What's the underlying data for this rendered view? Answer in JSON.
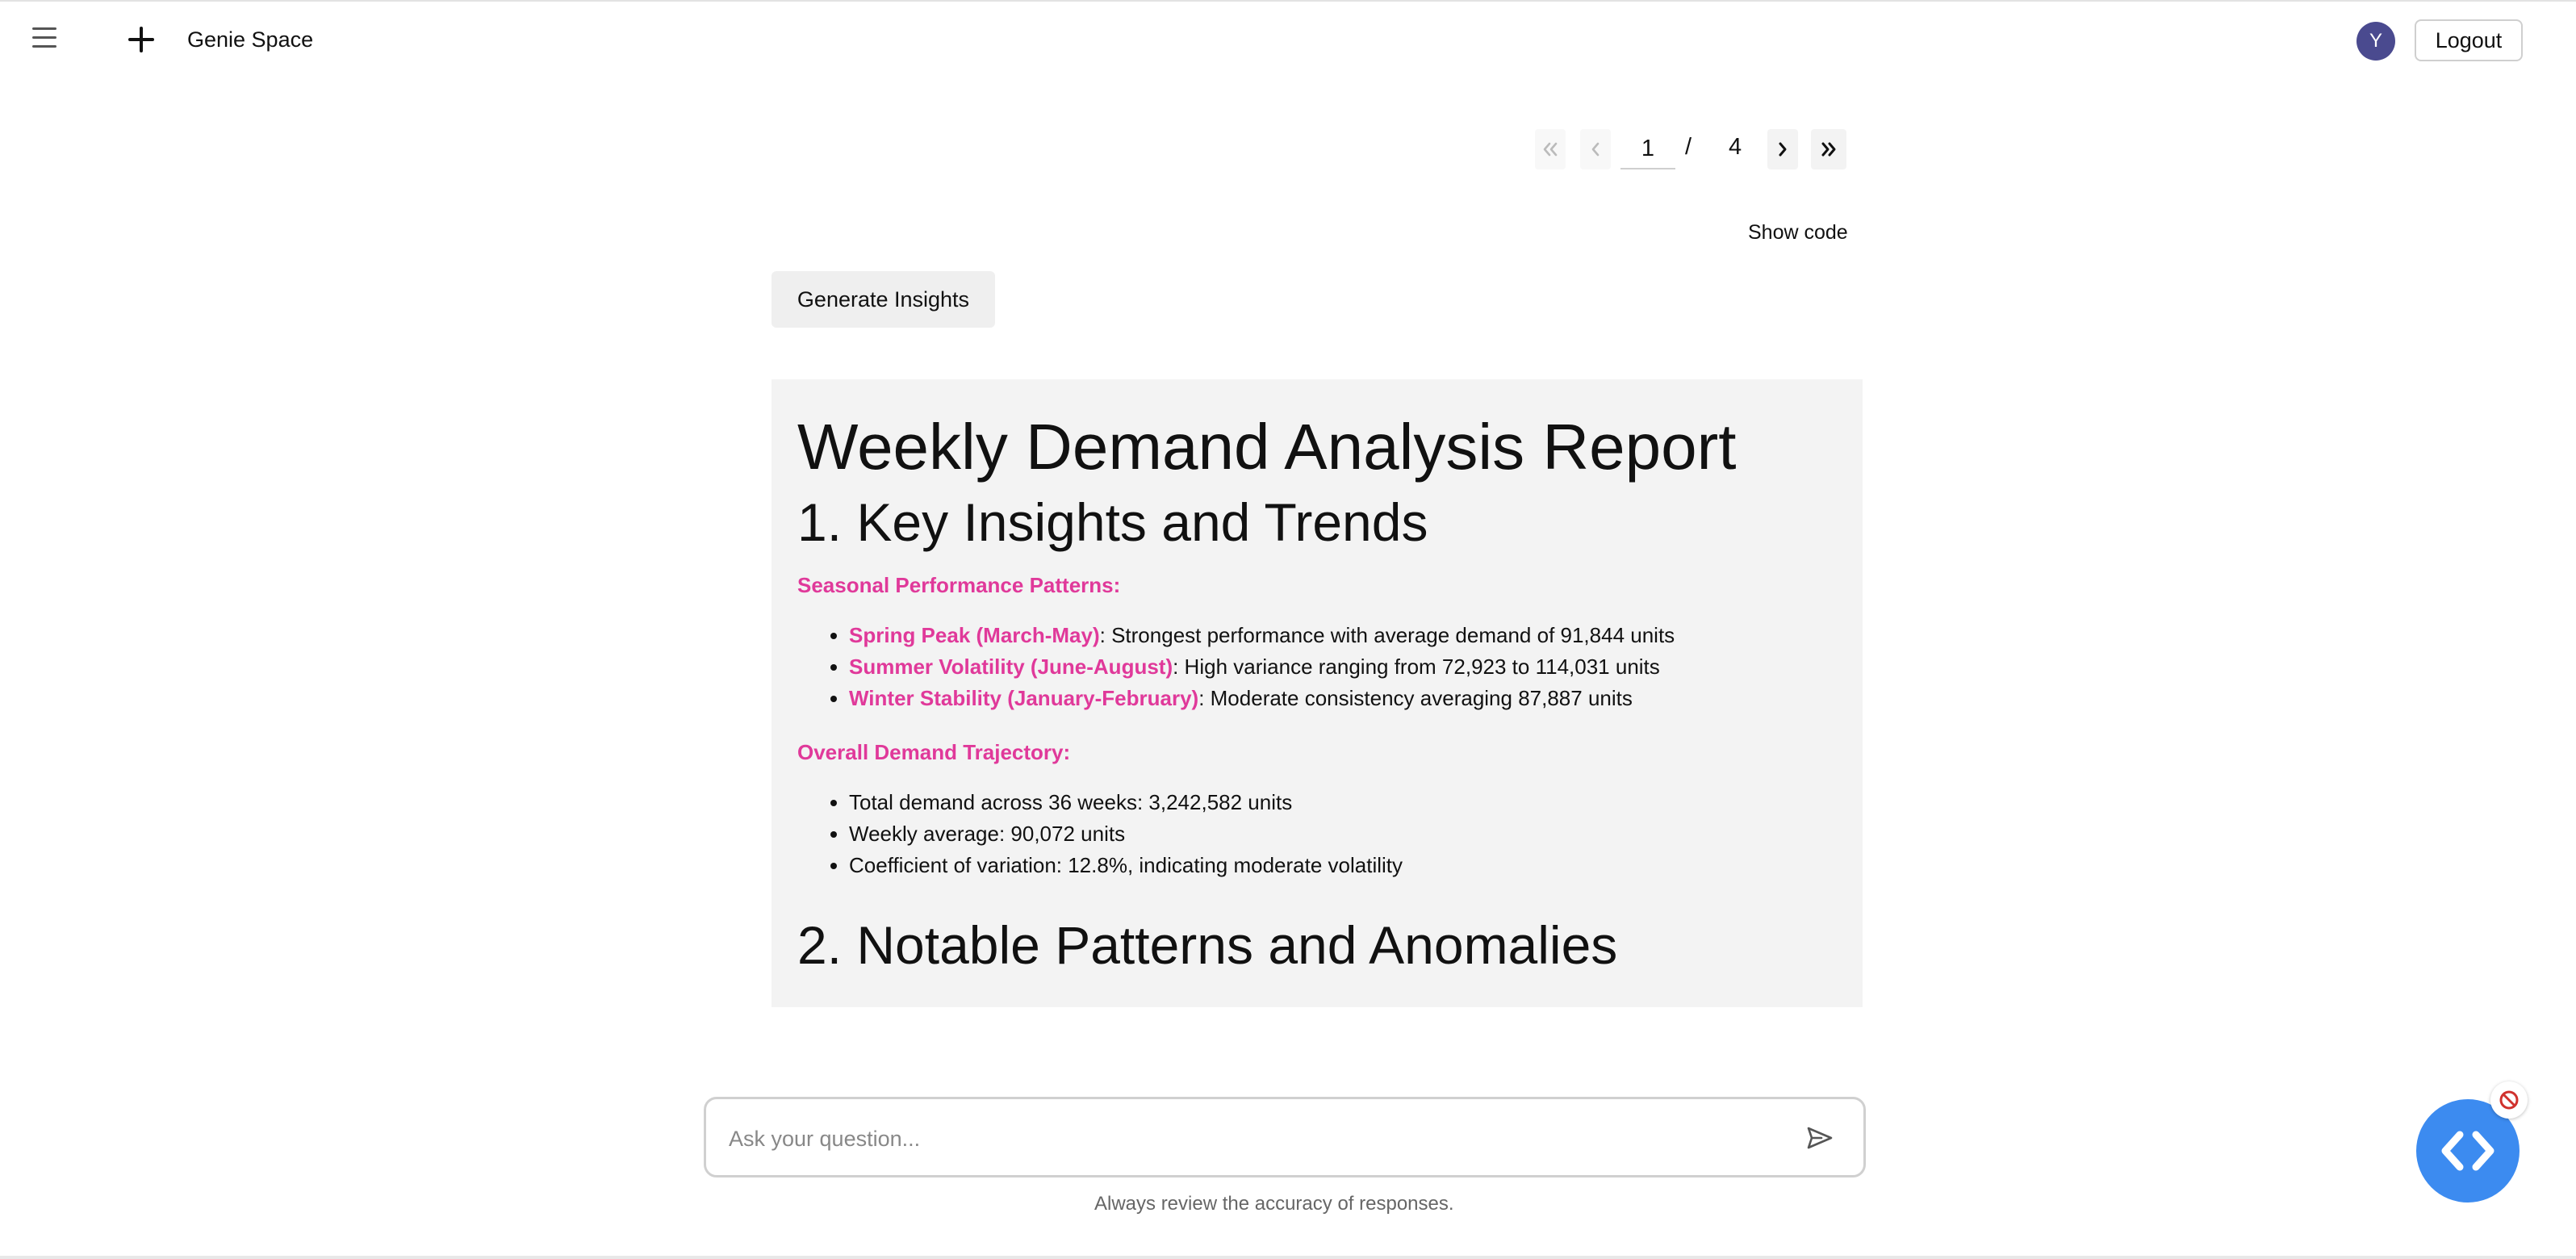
{
  "header": {
    "app_title": "Genie Space",
    "avatar_initial": "Y",
    "logout_label": "Logout"
  },
  "pagination": {
    "first_icon": "double-chevron-left-icon",
    "prev_icon": "chevron-left-icon",
    "current_page": "1",
    "separator": "/",
    "total_pages": "4",
    "next_icon": "chevron-right-icon",
    "last_icon": "double-chevron-right-icon"
  },
  "toolbar": {
    "show_code_label": "Show code",
    "generate_label": "Generate Insights"
  },
  "report": {
    "title": "Weekly Demand Analysis Report",
    "section1_title": "1. Key Insights and Trends",
    "seasonal_heading": "Seasonal Performance Patterns:",
    "seasonal_items": [
      {
        "label": "Spring Peak (March-May)",
        "text": ": Strongest performance with average demand of 91,844 units"
      },
      {
        "label": "Summer Volatility (June-August)",
        "text": ": High variance ranging from 72,923 to 114,031 units"
      },
      {
        "label": "Winter Stability (January-February)",
        "text": ": Moderate consistency averaging 87,887 units"
      }
    ],
    "trajectory_heading": "Overall Demand Trajectory:",
    "trajectory_items": [
      "Total demand across 36 weeks: 3,242,582 units",
      "Weekly average: 90,072 units",
      "Coefficient of variation: 12.8%, indicating moderate volatility"
    ],
    "section2_title": "2. Notable Patterns and Anomalies"
  },
  "input": {
    "placeholder": "Ask your question...",
    "value": "",
    "send_icon": "send-icon"
  },
  "disclaimer": "Always review the accuracy of responses.",
  "fab": {
    "icon": "code-brackets-icon",
    "badge_icon": "blocked-icon"
  },
  "colors": {
    "accent_pink": "#e0399a",
    "avatar_bg": "#4a4a8f",
    "fab_blue": "#3c8bf0",
    "report_bg": "#f3f3f3"
  }
}
